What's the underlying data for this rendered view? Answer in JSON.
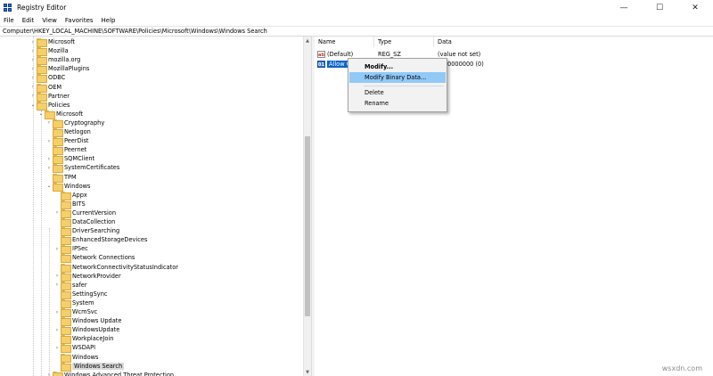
{
  "window": {
    "title": "Registry Editor",
    "controls": {
      "minimize": "—",
      "maximize": "☐",
      "close": "✕"
    }
  },
  "menu": [
    "File",
    "Edit",
    "View",
    "Favorites",
    "Help"
  ],
  "address": "Computer\\HKEY_LOCAL_MACHINE\\SOFTWARE\\Policies\\Microsoft\\Windows\\Windows Search",
  "tree": [
    {
      "label": "Microsoft",
      "depth": 0,
      "chevron": ">"
    },
    {
      "label": "Mozilla",
      "depth": 0,
      "chevron": ">"
    },
    {
      "label": "mozilla.org",
      "depth": 0,
      "chevron": ">"
    },
    {
      "label": "MozillaPlugins",
      "depth": 0,
      "chevron": ">"
    },
    {
      "label": "ODBC",
      "depth": 0,
      "chevron": ">"
    },
    {
      "label": "OEM",
      "depth": 0,
      "chevron": ">"
    },
    {
      "label": "Partner",
      "depth": 0,
      "chevron": ">"
    },
    {
      "label": "Policies",
      "depth": 0,
      "chevron": "v"
    },
    {
      "label": "Microsoft",
      "depth": 1,
      "chevron": "v"
    },
    {
      "label": "Cryptography",
      "depth": 2,
      "chevron": ">"
    },
    {
      "label": "Netlogon",
      "depth": 2,
      "chevron": ""
    },
    {
      "label": "PeerDist",
      "depth": 2,
      "chevron": ">"
    },
    {
      "label": "Peernet",
      "depth": 2,
      "chevron": ""
    },
    {
      "label": "SQMClient",
      "depth": 2,
      "chevron": ">"
    },
    {
      "label": "SystemCertificates",
      "depth": 2,
      "chevron": ">"
    },
    {
      "label": "TPM",
      "depth": 2,
      "chevron": ""
    },
    {
      "label": "Windows",
      "depth": 2,
      "chevron": "v"
    },
    {
      "label": "Appx",
      "depth": 3,
      "chevron": ""
    },
    {
      "label": "BITS",
      "depth": 3,
      "chevron": ""
    },
    {
      "label": "CurrentVersion",
      "depth": 3,
      "chevron": ">"
    },
    {
      "label": "DataCollection",
      "depth": 3,
      "chevron": ""
    },
    {
      "label": "DriverSearching",
      "depth": 3,
      "chevron": ""
    },
    {
      "label": "EnhancedStorageDevices",
      "depth": 3,
      "chevron": ""
    },
    {
      "label": "IPSec",
      "depth": 3,
      "chevron": ">"
    },
    {
      "label": "Network Connections",
      "depth": 3,
      "chevron": ""
    },
    {
      "label": "NetworkConnectivityStatusIndicator",
      "depth": 3,
      "chevron": ""
    },
    {
      "label": "NetworkProvider",
      "depth": 3,
      "chevron": ">"
    },
    {
      "label": "safer",
      "depth": 3,
      "chevron": ">"
    },
    {
      "label": "SettingSync",
      "depth": 3,
      "chevron": ""
    },
    {
      "label": "System",
      "depth": 3,
      "chevron": ""
    },
    {
      "label": "WcmSvc",
      "depth": 3,
      "chevron": ">"
    },
    {
      "label": "Windows Update",
      "depth": 3,
      "chevron": ""
    },
    {
      "label": "WindowsUpdate",
      "depth": 3,
      "chevron": ">"
    },
    {
      "label": "WorkplaceJoin",
      "depth": 3,
      "chevron": ""
    },
    {
      "label": "WSDAPI",
      "depth": 3,
      "chevron": ">"
    },
    {
      "label": "Windows",
      "depth": 3,
      "chevron": ""
    },
    {
      "label": "Windows Search",
      "depth": 3,
      "chevron": "",
      "selected": true
    },
    {
      "label": "Windows Advanced Threat Protection",
      "depth": 2,
      "chevron": ">"
    }
  ],
  "list": {
    "headers": {
      "name": "Name",
      "type": "Type",
      "data": "Data"
    },
    "rows": [
      {
        "icon": "ab",
        "name": "(Default)",
        "type": "REG_SZ",
        "data": "(value not set)",
        "selected": false
      },
      {
        "icon": "01",
        "name": "Allow C",
        "type": "",
        "data": "0000000 (0)",
        "selected": true
      }
    ]
  },
  "context_menu": {
    "items": [
      {
        "label": "Modify...",
        "bold": true
      },
      {
        "label": "Modify Binary Data...",
        "hover": true
      },
      {
        "separator": true
      },
      {
        "label": "Delete"
      },
      {
        "label": "Rename"
      }
    ]
  },
  "watermark": "wsxdn.com"
}
